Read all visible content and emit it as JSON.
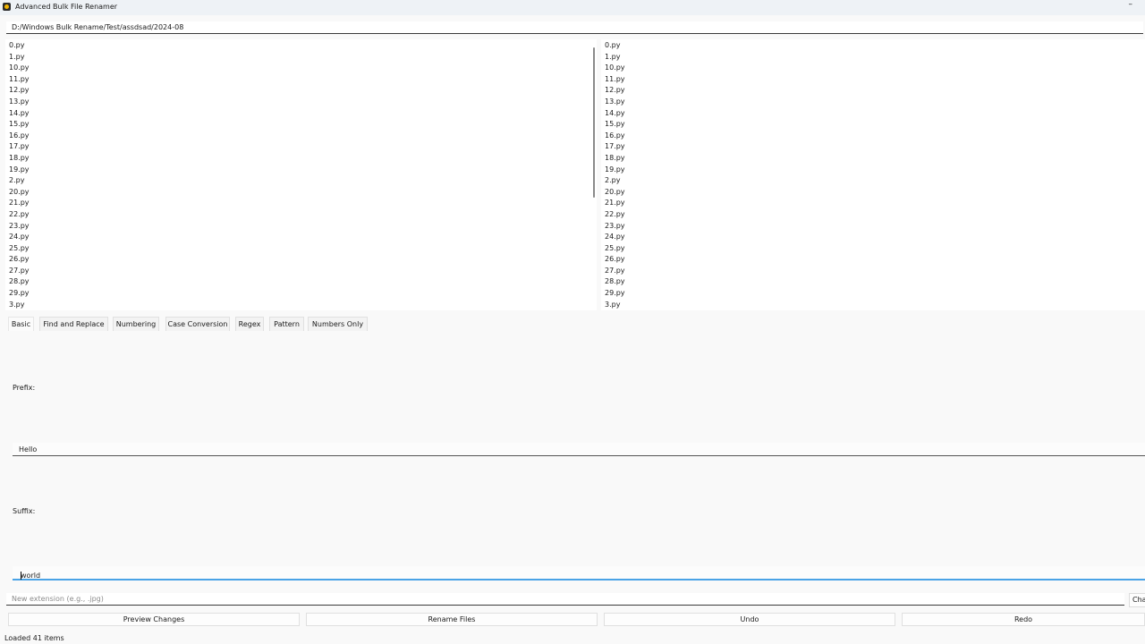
{
  "window": {
    "title": "Advanced Bulk File Renamer",
    "minimize_glyph": "–"
  },
  "path": {
    "value": "D:/Windows Bulk Rename/Test/assdsad/2024-08"
  },
  "original_files": [
    "0.py",
    "1.py",
    "10.py",
    "11.py",
    "12.py",
    "13.py",
    "14.py",
    "15.py",
    "16.py",
    "17.py",
    "18.py",
    "19.py",
    "2.py",
    "20.py",
    "21.py",
    "22.py",
    "23.py",
    "24.py",
    "25.py",
    "26.py",
    "27.py",
    "28.py",
    "29.py",
    "3.py"
  ],
  "preview_files": [
    "0.py",
    "1.py",
    "10.py",
    "11.py",
    "12.py",
    "13.py",
    "14.py",
    "15.py",
    "16.py",
    "17.py",
    "18.py",
    "19.py",
    "2.py",
    "20.py",
    "21.py",
    "22.py",
    "23.py",
    "24.py",
    "25.py",
    "26.py",
    "27.py",
    "28.py",
    "29.py",
    "3.py"
  ],
  "tabs": [
    {
      "label": "Basic"
    },
    {
      "label": "Find and Replace"
    },
    {
      "label": "Numbering"
    },
    {
      "label": "Case Conversion"
    },
    {
      "label": "Regex"
    },
    {
      "label": "Pattern"
    },
    {
      "label": "Numbers Only"
    }
  ],
  "basic": {
    "prefix_label": "Prefix:",
    "prefix_value": "Hello",
    "suffix_label": "Suffix:",
    "suffix_value": "world"
  },
  "extension": {
    "placeholder": "New extension (e.g., .jpg)",
    "change_label": "Change"
  },
  "buttons": {
    "preview": "Preview Changes",
    "rename": "Rename Files",
    "undo": "Undo",
    "redo": "Redo"
  },
  "status": "Loaded 41 items",
  "colors": {
    "accent": "#4aa3e6",
    "titlebar": "#eef2f6"
  },
  "icons": {
    "app": "app-icon",
    "minimize": "minimize-icon"
  }
}
